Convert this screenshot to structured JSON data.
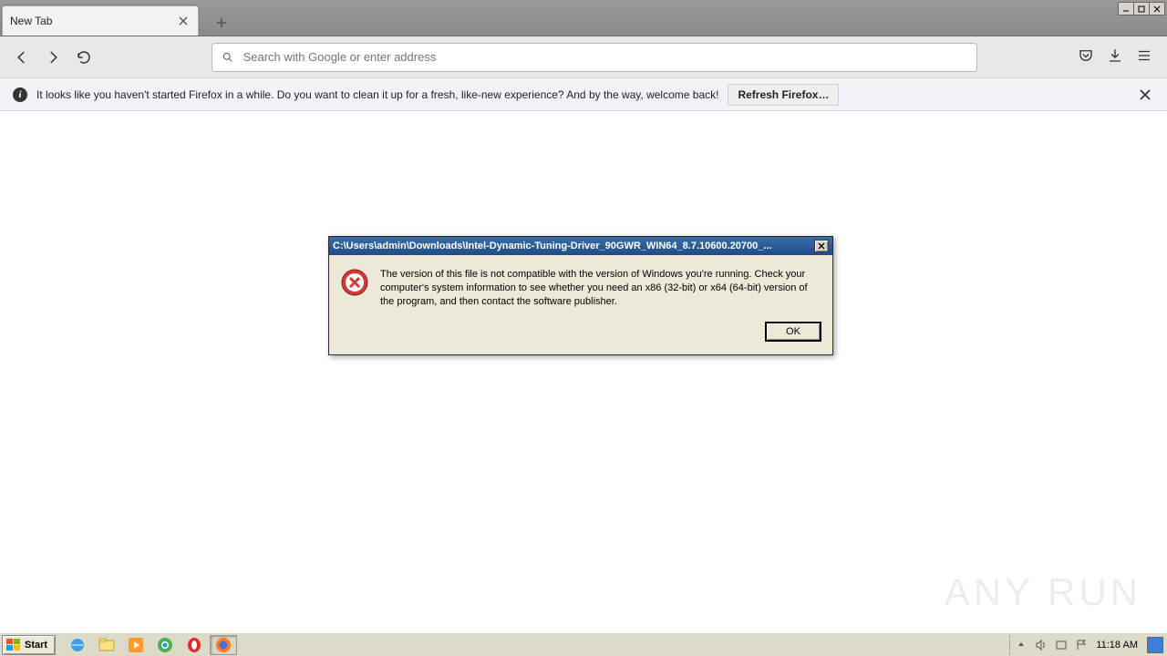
{
  "firefox": {
    "tab_title": "New Tab",
    "url_placeholder": "Search with Google or enter address",
    "infobar_text": "It looks like you haven't started Firefox in a while. Do you want to clean it up for a fresh, like-new experience? And by the way, welcome back!",
    "refresh_button": "Refresh Firefox…"
  },
  "dialog": {
    "title": "C:\\Users\\admin\\Downloads\\Intel-Dynamic-Tuning-Driver_90GWR_WIN64_8.7.10600.20700_...",
    "message": "The version of this file is not compatible with the version of Windows you're running. Check your computer's system information to see whether you need an x86 (32-bit) or x64 (64-bit) version of the program, and then contact the software publisher.",
    "ok": "OK"
  },
  "taskbar": {
    "start": "Start",
    "clock": "11:18 AM"
  },
  "watermark": "ANY    RUN"
}
